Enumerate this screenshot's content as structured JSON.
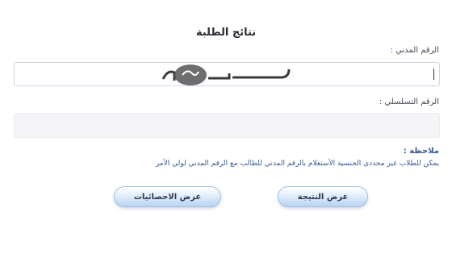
{
  "page": {
    "title": "نتائج الطلبة"
  },
  "form": {
    "civil_id_label": "الرقم المدني :",
    "civil_id_value": "",
    "serial_label": "الرقم التسلسلي :",
    "serial_value": ""
  },
  "note": {
    "title": "ملاحظة :",
    "text": "يمكن للطلاب غير محددي الجنسية الأستعلام بالرقم المدني للطالب مع الرقم المدني لولي الأمر"
  },
  "buttons": {
    "show_result": "عرض النتيجة",
    "show_stats": "عرض الاحصائيات"
  },
  "colors": {
    "note_color": "#3a5a8f",
    "button_border": "#9fc1e8"
  },
  "icons": {
    "watermark": "site-logo-watermark"
  }
}
